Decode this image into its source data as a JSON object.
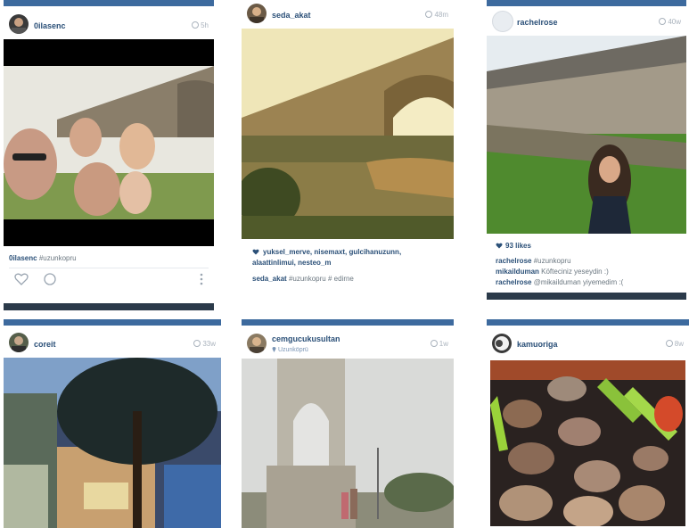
{
  "posts": [
    {
      "username": "0ilasenc",
      "time": "5h",
      "caption_user": "0ilasenc",
      "caption_text": "#uzunkopru"
    },
    {
      "username": "seda_akat",
      "time": "48m",
      "likers": "yuksel_merve, nisemaxt, gulcihanuzunn,",
      "likers2": "alaattinlimui, nesteo_m",
      "caption_user": "seda_akat",
      "caption_text": "#uzunkopru # edirne"
    },
    {
      "username": "rachelrose",
      "time": "40w",
      "likes": "93 likes",
      "comment1_user": "rachelrose",
      "comment1_text": "#uzunkopru",
      "comment2_user": "mikailduman",
      "comment2_text": "Köfteciniz yeseydin :)",
      "comment3_user": "rachelrose",
      "comment3_text": "@mikailduman yiyemedim :("
    },
    {
      "username": "coreit",
      "time": "33w"
    },
    {
      "username": "cemgucukusultan",
      "time": "1w",
      "location": "Uzunköprü"
    },
    {
      "username": "kamuoriga",
      "time": "8w"
    }
  ],
  "icons": {
    "heart": "heart-icon",
    "comment": "comment-icon",
    "more": "more-icon",
    "clock": "clock-icon",
    "pin": "location-pin-icon"
  },
  "colors": {
    "accent": "#3d6a9e",
    "username": "#2b5078"
  }
}
